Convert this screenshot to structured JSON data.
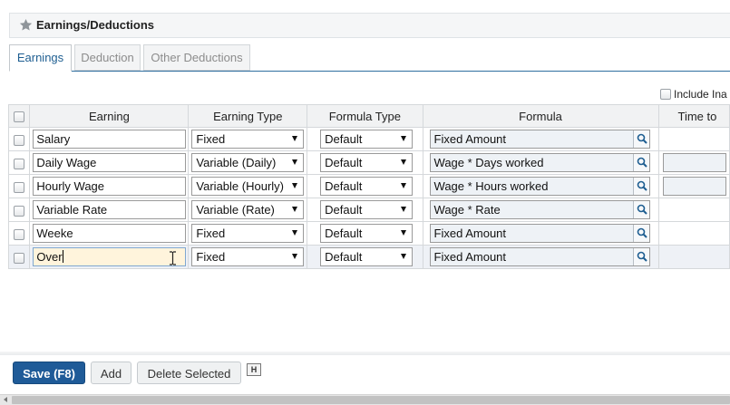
{
  "header": {
    "title": "Earnings/Deductions",
    "icon": "star-icon"
  },
  "tabs": [
    {
      "label": "Earnings",
      "active": true
    },
    {
      "label": "Deduction",
      "active": false
    },
    {
      "label": "Other Deductions",
      "active": false
    }
  ],
  "include_inactive": {
    "label": "Include Ina",
    "checked": false
  },
  "grid": {
    "columns": [
      "Earning",
      "Earning Type",
      "Formula Type",
      "Formula",
      "Time to"
    ],
    "rows": [
      {
        "earning": "Salary",
        "earning_type": "Fixed",
        "formula_type": "Default",
        "formula": "Fixed Amount",
        "time": false
      },
      {
        "earning": "Daily Wage",
        "earning_type": "Variable (Daily)",
        "formula_type": "Default",
        "formula": "Wage * Days worked",
        "time": true
      },
      {
        "earning": "Hourly Wage",
        "earning_type": "Variable (Hourly)",
        "formula_type": "Default",
        "formula": "Wage * Hours worked",
        "time": true
      },
      {
        "earning": "Variable Rate",
        "earning_type": "Variable (Rate)",
        "formula_type": "Default",
        "formula": "Wage * Rate",
        "time": false
      },
      {
        "earning": "Weeke",
        "earning_type": "Fixed",
        "formula_type": "Default",
        "formula": "Fixed Amount",
        "time": false
      },
      {
        "earning": "Over",
        "earning_type": "Fixed",
        "formula_type": "Default",
        "formula": "Fixed Amount",
        "time": false,
        "editing": true
      }
    ]
  },
  "footer": {
    "save_label": "Save (F8)",
    "add_label": "Add",
    "delete_label": "Delete Selected",
    "hotkey_label": "H"
  },
  "colors": {
    "primary_button": "#1f5b98",
    "tab_active_text": "#1e5e91",
    "editing_field": "#fff4dc",
    "formula_field": "#eef2f6"
  }
}
